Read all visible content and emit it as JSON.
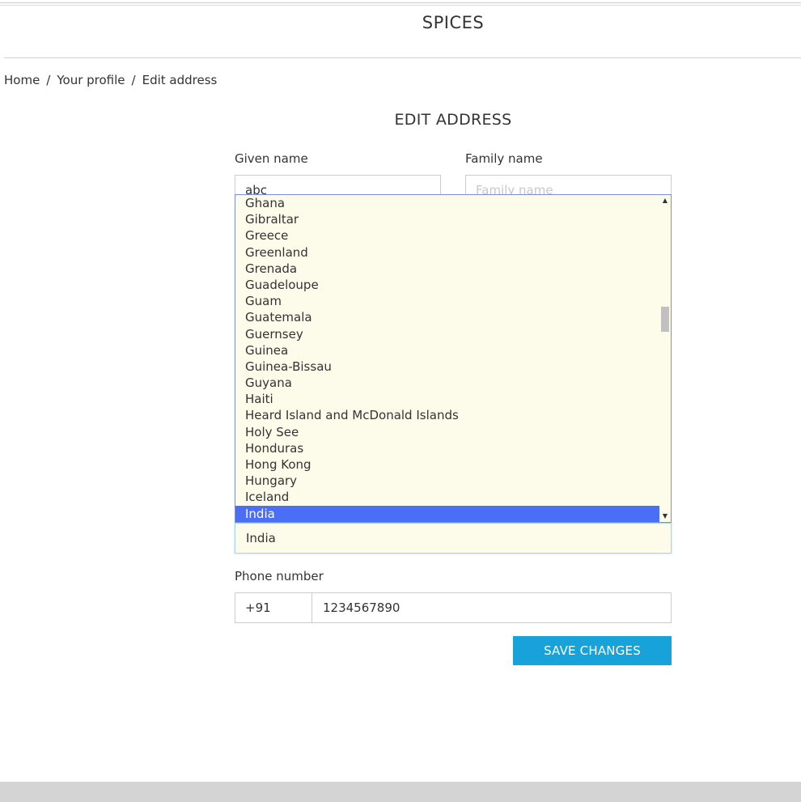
{
  "header": {
    "brand": "SPICES"
  },
  "breadcrumb": {
    "items": [
      "Home",
      "Your profile",
      "Edit address"
    ],
    "separator": "/"
  },
  "page": {
    "title": "EDIT ADDRESS"
  },
  "form": {
    "given_name": {
      "label": "Given name",
      "value": "abc"
    },
    "family_name": {
      "label": "Family name",
      "placeholder": "Family name"
    },
    "country": {
      "value": "India",
      "options": [
        "Ghana",
        "Gibraltar",
        "Greece",
        "Greenland",
        "Grenada",
        "Guadeloupe",
        "Guam",
        "Guatemala",
        "Guernsey",
        "Guinea",
        "Guinea-Bissau",
        "Guyana",
        "Haiti",
        "Heard Island and McDonald Islands",
        "Holy See",
        "Honduras",
        "Hong Kong",
        "Hungary",
        "Iceland",
        "India"
      ],
      "selected": "India"
    },
    "phone": {
      "label": "Phone number",
      "code": "+91",
      "number": "1234567890"
    },
    "save_label": "SAVE CHANGES"
  },
  "icons": {
    "scroll_up": "triangle-up-icon",
    "scroll_down": "triangle-down-icon"
  },
  "colors": {
    "accent_button": "#17a2d9",
    "selected_option": "#4a6ef5",
    "dropdown_background": "#fdfbea"
  }
}
